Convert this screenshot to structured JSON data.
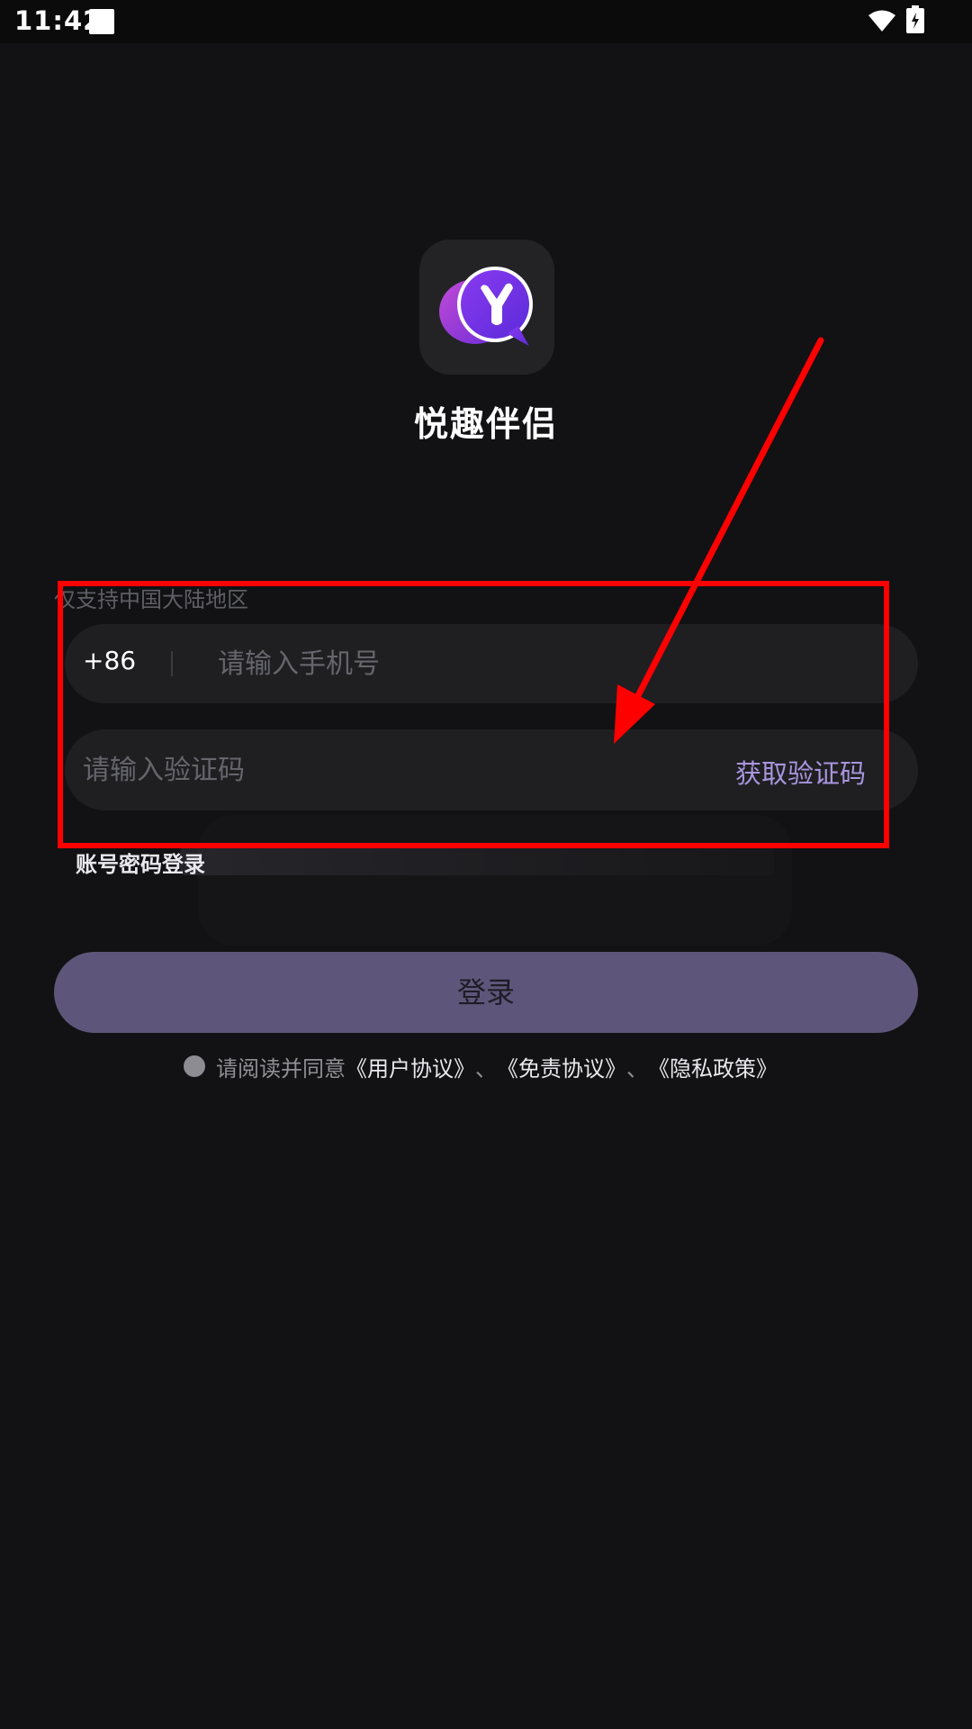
{
  "status_bar": {
    "time": "11:42"
  },
  "app": {
    "name": "悦趣伴侣",
    "logo": "app-logo-y-bubble"
  },
  "form": {
    "region_hint": "仅支持中国大陆地区",
    "country_code": "+86",
    "phone_placeholder": "请输入手机号",
    "code_placeholder": "请输入验证码",
    "get_code_label": "获取验证码",
    "password_login_label": "账号密码登录"
  },
  "login_button": {
    "label": "登录"
  },
  "agreement": {
    "prefix": "请阅读并同意",
    "links": [
      "《用户协议》",
      "《免责协议》",
      "《隐私政策》"
    ],
    "separator": "、"
  },
  "colors": {
    "background": "#121214",
    "input_bg": "#1f1f22",
    "accent": "#a996dd",
    "login_button": "#5e567a",
    "annotation": "#ff0000"
  }
}
